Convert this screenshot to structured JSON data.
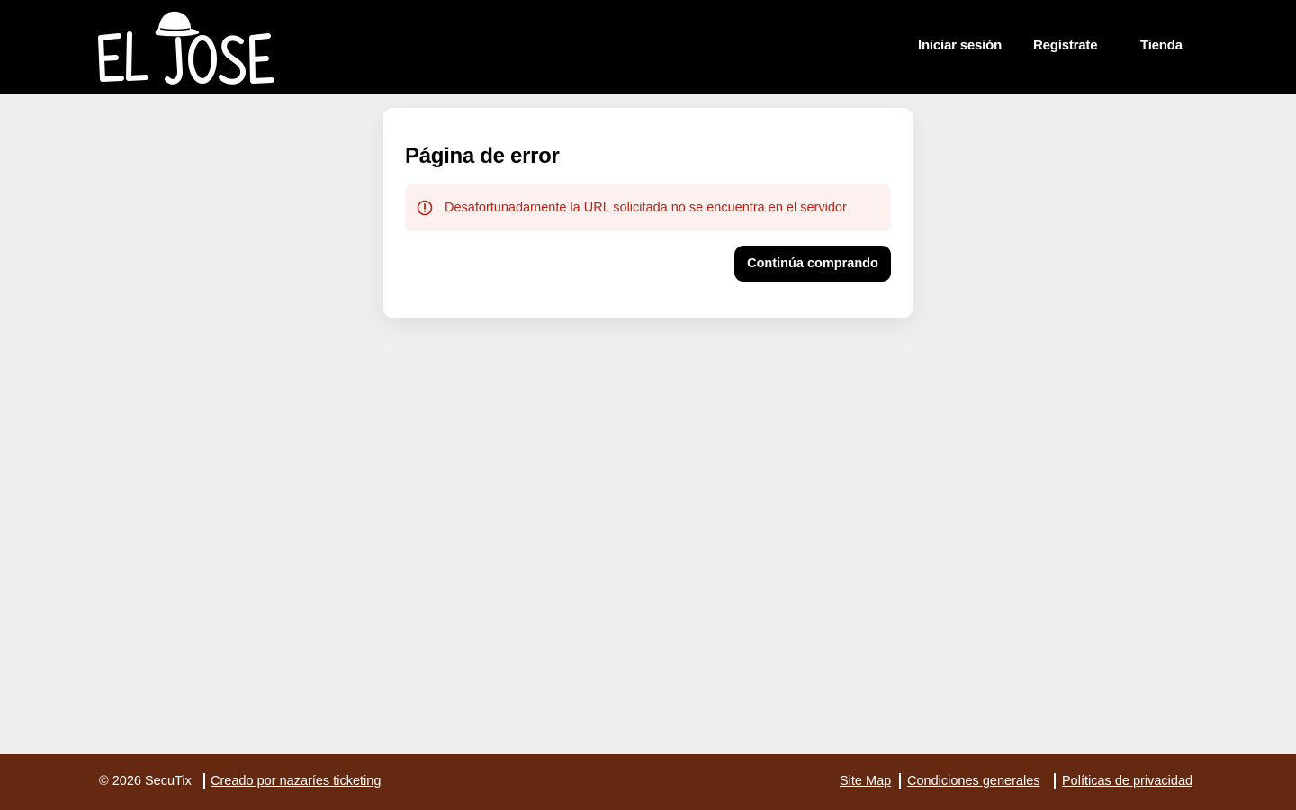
{
  "header": {
    "logo_text": "EL JOSE",
    "nav": {
      "login": "Iniciar sesión",
      "register": "Regístrate",
      "shop": "Tienda"
    }
  },
  "main": {
    "title": "Página de error",
    "alert": {
      "icon": "alert-circle-icon",
      "message": "Desafortunadamente la URL solicitada no se encuentra en el servidor"
    },
    "continue_label": "Continúa comprando"
  },
  "footer": {
    "copyright": "© 2026 SecuTix",
    "created_by": "Creado por nazaríes ticketing",
    "site_map": "Site Map",
    "conditions": "Condiciones generales",
    "privacy": "Políticas de privacidad"
  },
  "colors": {
    "header_bg": "#000000",
    "page_bg": "#efefef",
    "footer_bg": "#652912",
    "alert_bg": "#fdf1ef",
    "alert_text": "#b42318",
    "button_bg": "#000000"
  }
}
